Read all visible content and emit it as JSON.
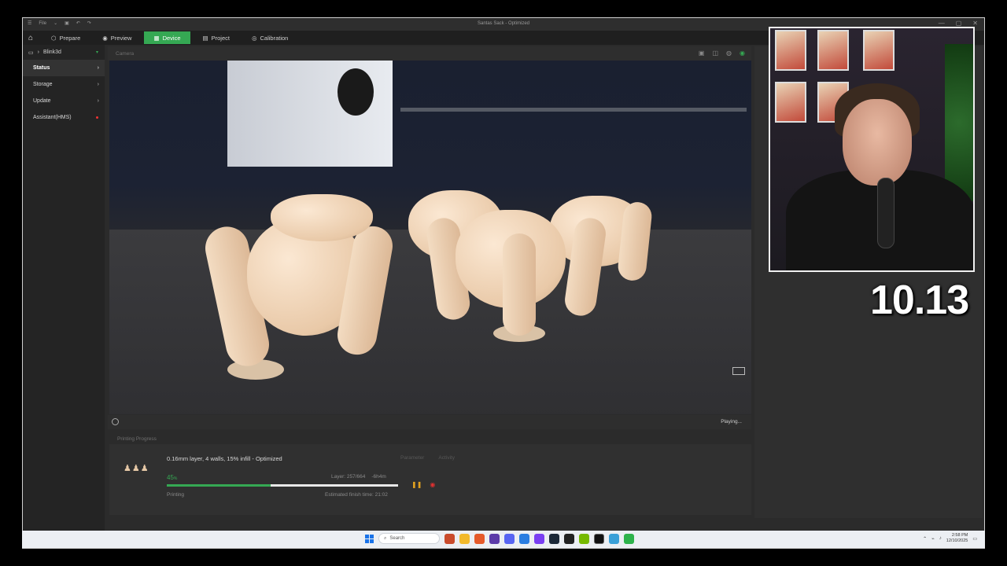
{
  "window": {
    "title": "Santas Sack - Optimized",
    "menu_label": "File",
    "controls": [
      "—",
      "▢",
      "✕"
    ]
  },
  "nav": {
    "tabs": [
      {
        "label": "Prepare",
        "icon": "cube-icon"
      },
      {
        "label": "Preview",
        "icon": "eye-icon"
      },
      {
        "label": "Device",
        "icon": "device-icon",
        "active": true
      },
      {
        "label": "Project",
        "icon": "project-icon"
      },
      {
        "label": "Calibration",
        "icon": "calibration-icon"
      }
    ]
  },
  "sidebar": {
    "device_name": "Blink3d",
    "items": [
      {
        "label": "Status",
        "active": true
      },
      {
        "label": "Storage"
      },
      {
        "label": "Update"
      },
      {
        "label": "Assistant(HMS)",
        "alert": true
      }
    ]
  },
  "camera": {
    "header": "Camera",
    "status": "Playing..."
  },
  "progress": {
    "header": "Printing Progress",
    "description": "0.16mm layer, 4 walls, 15% infill - Optimized",
    "tabs": [
      "Parameter",
      "Activity"
    ],
    "percent": "45",
    "percent_unit": "%",
    "percent_value": 45,
    "layer": "Layer: 257/664",
    "remaining": "-6h4m",
    "state": "Printing",
    "finish": "Estimated finish time: 21:02"
  },
  "overlay": {
    "counter": "10.13"
  },
  "taskbar": {
    "search_label": "Search",
    "time": "2:58 PM",
    "date": "12/10/2025"
  },
  "colors": {
    "accent": "#35a853",
    "alert": "#e03030",
    "pause": "#e0a020"
  }
}
